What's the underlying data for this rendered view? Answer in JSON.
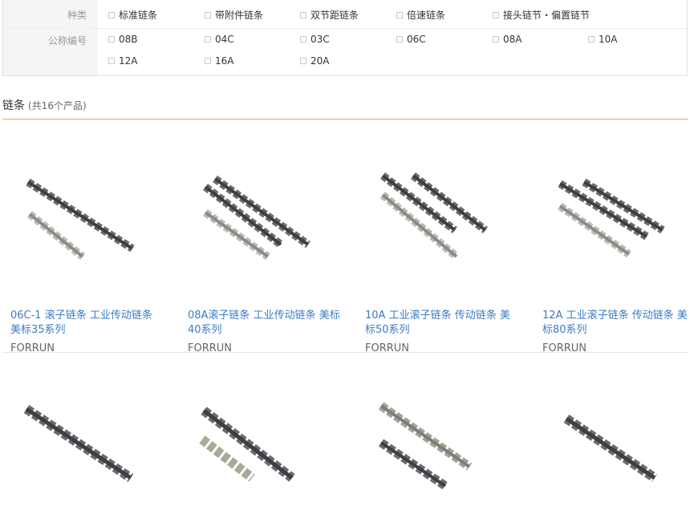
{
  "filters": {
    "species": {
      "label": "种类",
      "options": [
        "标准链条",
        "带附件链条",
        "双节距链条",
        "倍速链条",
        "接头链节・偏置链节"
      ]
    },
    "spec": {
      "label": "公称编号",
      "options": [
        "08B",
        "04C",
        "03C",
        "06C",
        "08A",
        "10A",
        "12A",
        "16A",
        "20A"
      ]
    }
  },
  "section": {
    "title": "链条",
    "count": "(共16个产品)"
  },
  "products": [
    {
      "title": "06C-1 滚子链条 工业传动链条 美标35系列",
      "brand": "FORRUN"
    },
    {
      "title": "08A滚子链条 工业传动链条 美标40系列",
      "brand": "FORRUN"
    },
    {
      "title": "10A 工业滚子链条 传动链条 美标50系列",
      "brand": "FORRUN"
    },
    {
      "title": "12A 工业滚子链条 传动链条 美标80系列",
      "brand": "FORRUN"
    }
  ],
  "colors": {
    "link": "#3b7bc5",
    "accent_line": "#f0a830",
    "chain_dark": "#4a4d52",
    "chain_silver": "#b8b9b4"
  }
}
